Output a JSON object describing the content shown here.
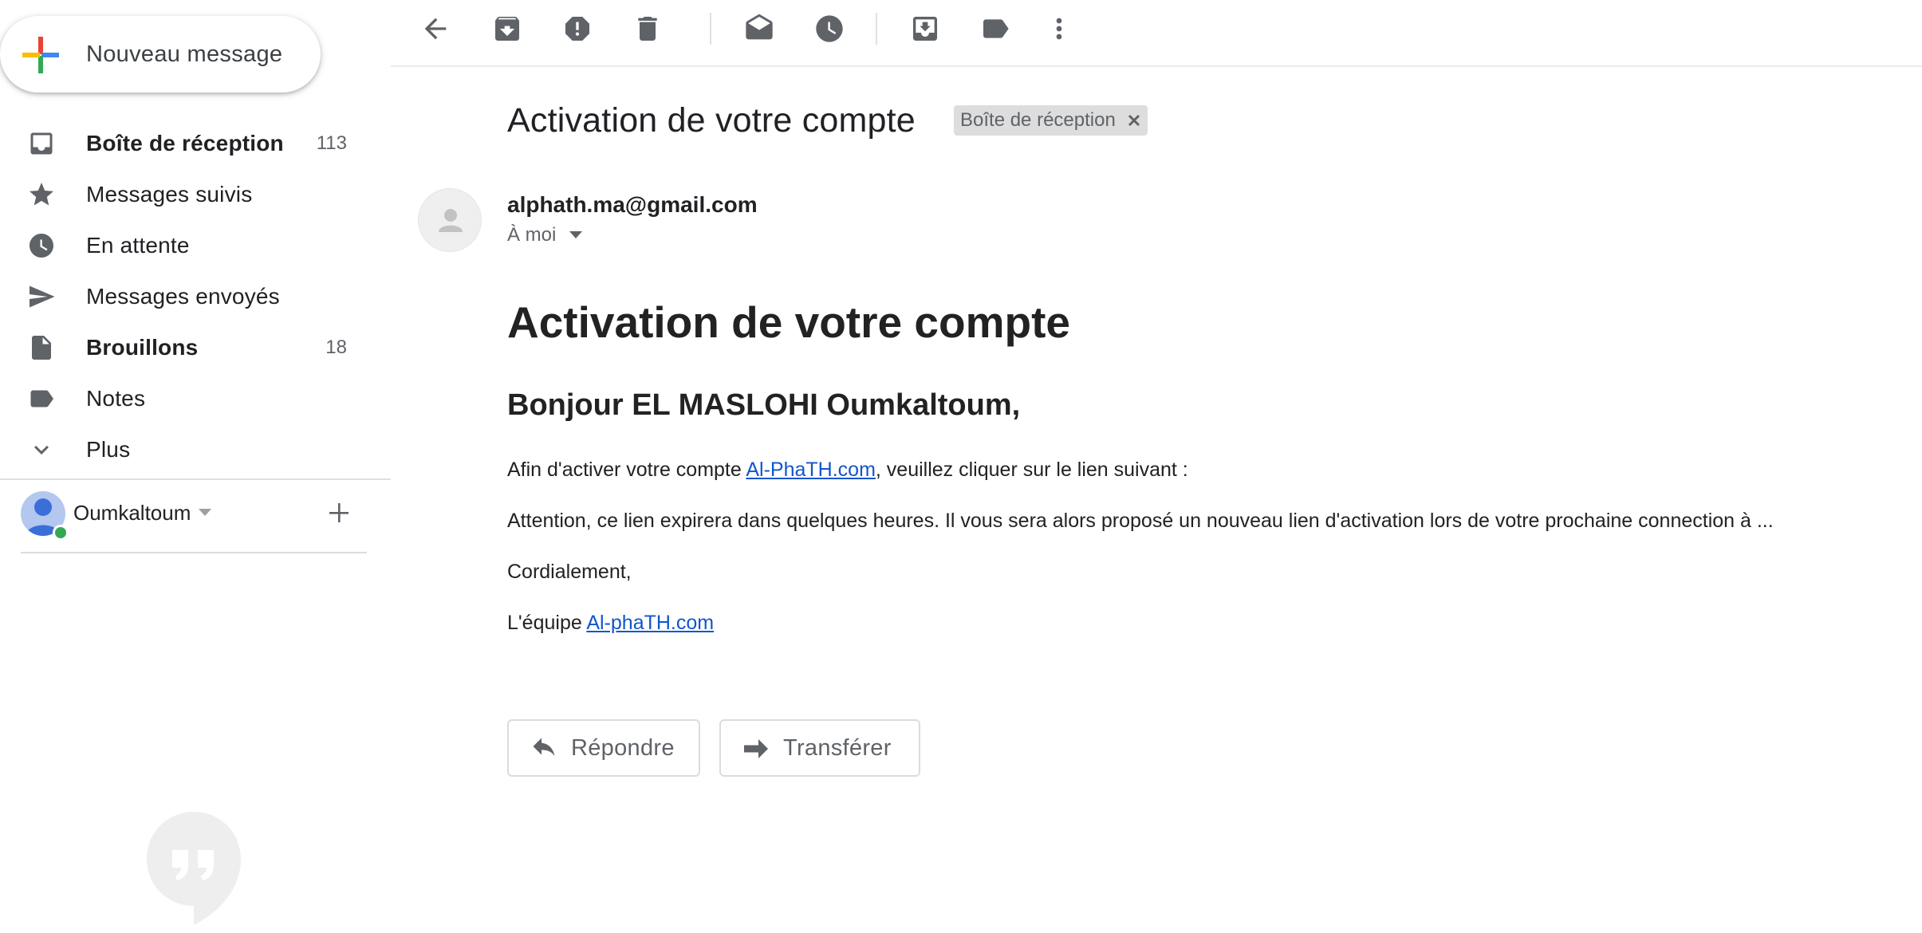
{
  "sidebar": {
    "compose_label": "Nouveau message",
    "items": [
      {
        "label": "Boîte de réception",
        "count": "113",
        "icon": "inbox-icon"
      },
      {
        "label": "Messages suivis",
        "count": "",
        "icon": "star-icon"
      },
      {
        "label": "En attente",
        "count": "",
        "icon": "clock-icon"
      },
      {
        "label": "Messages envoyés",
        "count": "",
        "icon": "send-icon"
      },
      {
        "label": "Brouillons",
        "count": "18",
        "icon": "draft-icon"
      },
      {
        "label": "Notes",
        "count": "",
        "icon": "label-icon"
      },
      {
        "label": "Plus",
        "count": "",
        "icon": "chevron-down-icon"
      }
    ],
    "account_name": "Oumkaltoum"
  },
  "toolbar": {
    "icons": [
      "back-arrow-icon",
      "archive-icon",
      "report-spam-icon",
      "delete-icon",
      "mark-unread-icon",
      "snooze-icon",
      "move-to-icon",
      "label-icon",
      "more-icon"
    ]
  },
  "message": {
    "subject": "Activation de votre compte",
    "label_chip": "Boîte de réception",
    "sender_email": "alphath.ma@gmail.com",
    "recipient": "À moi",
    "heading": "Activation de votre compte",
    "greeting": "Bonjour EL MASLOHI Oumkaltoum,",
    "line1_before": "Afin d'activer votre compte ",
    "line1_link": "Al-PhaTH.com",
    "line1_after": ", veuillez cliquer sur le lien suivant :",
    "line2": "Attention, ce lien expirera dans quelques heures. Il vous sera alors proposé un nouveau lien d'activation lors de votre prochaine connection à ...",
    "line3": "Cordialement,",
    "line4_before": "L'équipe ",
    "line4_link": "Al-phaTH.com"
  },
  "actions": {
    "reply_label": "Répondre",
    "forward_label": "Transférer"
  },
  "colors": {
    "link": "#1155cc",
    "icon": "#5f6368",
    "online": "#34a853"
  }
}
